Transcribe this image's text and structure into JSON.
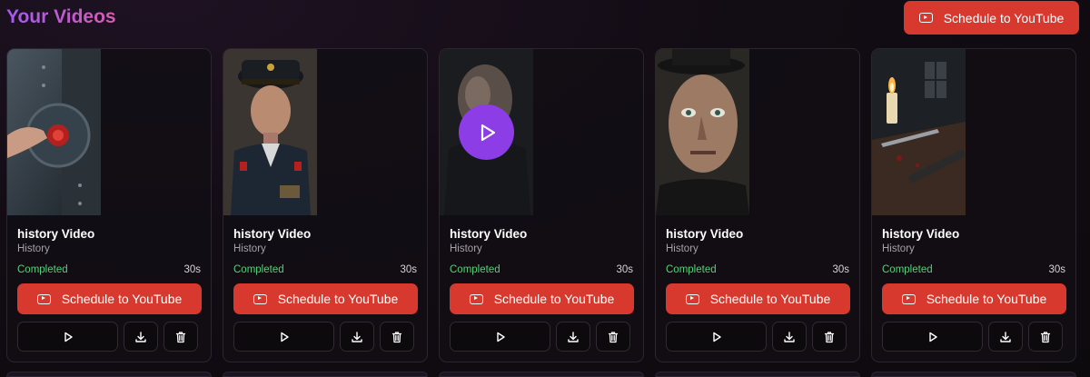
{
  "header": {
    "title": "Your Videos",
    "schedule_label": "Schedule to YouTube"
  },
  "colors": {
    "accent_red": "#d7392f",
    "play_purple": "#8c3de6",
    "status_green": "#57d07a",
    "title_gradient": [
      "#a35bf2",
      "#d65cb0"
    ]
  },
  "videos": [
    {
      "title": "history Video",
      "category": "History",
      "status": "Completed",
      "duration": "30s",
      "schedule_label": "Schedule to YouTube",
      "thumbnail": "vault-door-red-button"
    },
    {
      "title": "history Video",
      "category": "History",
      "status": "Completed",
      "duration": "30s",
      "schedule_label": "Schedule to YouTube",
      "thumbnail": "military-officer-portrait"
    },
    {
      "title": "history Video",
      "category": "History",
      "status": "Completed",
      "duration": "30s",
      "schedule_label": "Schedule to YouTube",
      "thumbnail": "man-in-shadow",
      "hover_play": true
    },
    {
      "title": "history Video",
      "category": "History",
      "status": "Completed",
      "duration": "30s",
      "schedule_label": "Schedule to YouTube",
      "thumbnail": "man-with-hat-closeup"
    },
    {
      "title": "history Video",
      "category": "History",
      "status": "Completed",
      "duration": "30s",
      "schedule_label": "Schedule to YouTube",
      "thumbnail": "candle-and-knives"
    }
  ],
  "icons": {
    "youtube": "youtube-icon",
    "play": "play-icon",
    "download": "download-icon",
    "delete": "trash-icon"
  }
}
